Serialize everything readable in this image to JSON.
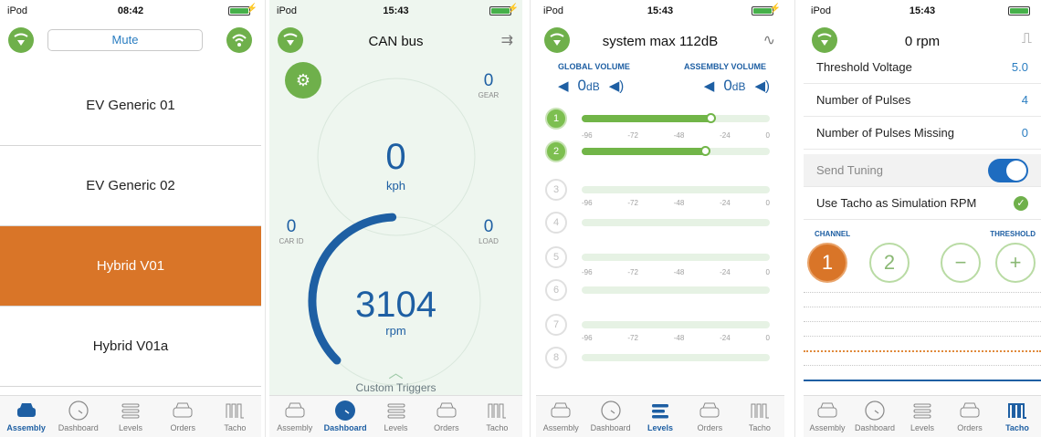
{
  "tabs": [
    "Assembly",
    "Dashboard",
    "Levels",
    "Orders",
    "Tacho"
  ],
  "colors": {
    "accent_green": "#6fb04b",
    "selected_orange": "#d97528",
    "blue": "#1e5fa3"
  },
  "screen1": {
    "carrier": "iPod",
    "time": "08:42",
    "mute_label": "Mute",
    "items": [
      "EV Generic 01",
      "EV Generic 02",
      "Hybrid V01",
      "Hybrid V01a"
    ],
    "selected_item": "Hybrid V01",
    "active_tab": "Assembly"
  },
  "screen2": {
    "carrier": "iPod",
    "time": "15:43",
    "title": "CAN bus",
    "gear_value": "0",
    "gear_label": "GEAR",
    "speed_value": "0",
    "speed_unit": "kph",
    "car_id_value": "0",
    "car_id_label": "CAR ID",
    "load_value": "0",
    "load_label": "LOAD",
    "rpm_value": "3104",
    "rpm_unit": "rpm",
    "rpm_arc_fraction": 0.35,
    "custom_triggers": "Custom Triggers",
    "active_tab": "Dashboard"
  },
  "screen3": {
    "carrier": "iPod",
    "time": "15:43",
    "title": "system max 112dB",
    "global_volume_label": "GLOBAL VOLUME",
    "assembly_volume_label": "ASSEMBLY VOLUME",
    "global_volume_value": "0",
    "assembly_volume_value": "0",
    "unit": "dB",
    "scale": [
      "-96",
      "-72",
      "-48",
      "-24",
      "0"
    ],
    "channels": [
      {
        "num": "1",
        "on": true,
        "level": 0.69
      },
      {
        "num": "2",
        "on": true,
        "level": 0.66
      },
      {
        "num": "3",
        "on": false,
        "level": 0
      },
      {
        "num": "4",
        "on": false,
        "level": 0
      },
      {
        "num": "5",
        "on": false,
        "level": 0
      },
      {
        "num": "6",
        "on": false,
        "level": 0
      },
      {
        "num": "7",
        "on": false,
        "level": 0
      },
      {
        "num": "8",
        "on": false,
        "level": 0
      }
    ],
    "active_tab": "Levels"
  },
  "screen4": {
    "carrier": "iPod",
    "time": "15:43",
    "title": "0 rpm",
    "threshold_voltage_label": "Threshold Voltage",
    "threshold_voltage_value": "5.0",
    "num_pulses_label": "Number of Pulses",
    "num_pulses_value": "4",
    "num_pulses_missing_label": "Number of Pulses Missing",
    "num_pulses_missing_value": "0",
    "send_tuning_label": "Send Tuning",
    "use_tacho_label": "Use Tacho as Simulation RPM",
    "channel_label": "CHANNEL",
    "threshold_label": "THRESHOLD",
    "channel_1": "1",
    "channel_2": "2",
    "minus": "−",
    "plus": "+",
    "active_tab": "Tacho"
  }
}
